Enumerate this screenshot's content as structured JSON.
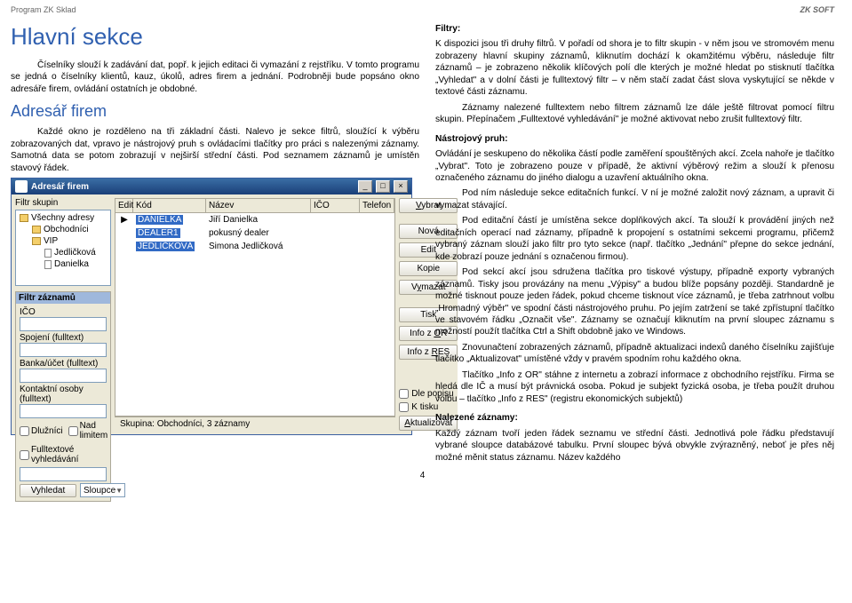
{
  "header": {
    "left": "Program ZK Sklad",
    "right": "ZK SOFT"
  },
  "left": {
    "h1": "Hlavní sekce",
    "p1": "Číselníky slouží k zadávání dat, popř. k jejich editaci či vymazání z rejstříku. V tomto programu se jedná o číselníky klientů, kauz, úkolů, adres firem a jednání. Podrobněji bude popsáno okno adresáře firem, ovládání ostatních je obdobné.",
    "h2": "Adresář firem",
    "p2": "Každé okno je rozděleno na tři základní části. Nalevo je sekce filtrů, sloužící k výběru zobrazovaných dat, vpravo je nástrojový pruh s ovládacími tlačítky pro práci s nalezenými záznamy. Samotná data se potom zobrazují v nejširší střední části. Pod seznamem záznamů je umístěn stavový řádek."
  },
  "right": {
    "filtry_head": "Filtry:",
    "filtry_body": "K dispozici jsou tři druhy filtrů. V pořadí od shora je to filtr skupin - v něm jsou ve stromovém menu zobrazeny hlavní skupiny záznamů, kliknutím dochází k okamžitému výběru, následuje filtr záznamů – je zobrazeno několik klíčových polí dle kterých je možné hledat po stisknutí tlačítka „Vyhledat\" a v dolní části je fulltextový filtr  – v něm stačí zadat část slova vyskytující se někde v textové části záznamu.",
    "filtry_body2": "Záznamy nalezené fulltextem nebo filtrem záznamů lze dále ještě filtrovat pomocí filtru skupin. Přepínačem „Fulltextové vyhledávání\" je možné aktivovat nebo zrušit fulltextový filtr.",
    "nastroj_head": "Nástrojový pruh:",
    "nastroj_p1": "Ovládání je seskupeno do několika částí podle zaměření spouštěných akcí. Zcela nahoře je tlačítko „Vybrat\". Toto je zobrazeno pouze v případě, že aktivní výběrový režim a slouží k přenosu označeného záznamu do jiného dialogu a uzavření aktuálního okna.",
    "nastroj_p2": "Pod ním následuje sekce editačních funkcí. V ní je možné založit nový záznam, a upravit či vymazat stávající.",
    "nastroj_p3": "Pod editační částí je umístěna sekce doplňkových akcí. Ta slouží k provádění jiných než editačních operací nad záznamy, případně k propojení s ostatními sekcemi programu, přičemž vybraný záznam slouží jako filtr pro tyto sekce (např. tlačítko „Jednání\" přepne do sekce jednání, kde zobrazí pouze jednání s označenou firmou).",
    "nastroj_p4": "Pod sekcí akcí jsou sdružena tlačítka pro tiskové výstupy, případně exporty vybraných záznamů. Tisky jsou provázány na menu „Výpisy\" a budou blíže popsány později. Standardně je možné tisknout pouze jeden řádek, pokud chceme tisknout více záznamů, je třeba zatrhnout volbu „Hromadný výběr\" ve spodní části nástrojového pruhu. Po jejím zatržení se také zpřístupní tlačítko ve stavovém řádku „Označit vše\". Záznamy se označují kliknutím na první sloupec záznamu s možností použít tlačítka Ctrl a Shift obdobně jako ve Windows.",
    "nastroj_p5": "Znovunačtení zobrazených záznamů, případně aktualizaci indexů daného číselníku zajišťuje tlačítko „Aktualizovat\" umístěné vždy v pravém spodním rohu každého okna.",
    "nastroj_p6": "Tlačítko „Info z OR\" stáhne z internetu a zobrazí informace z obchodního rejstříku. Firma se hledá dle IČ a musí být právnická osoba. Pokud je subjekt fyzická osoba, je třeba použít druhou volbu – tlačítko „Info z RES\" (registru ekonomických subjektů)",
    "nalez_head": "Nalezené záznamy:",
    "nalez_p1": "Každý záznam tvoří jeden řádek seznamu ve střední části. Jednotlivá pole řádku představují vybrané sloupce databázové tabulku. První sloupec bývá obvykle zvýrazněný, neboť je přes něj možné měnit status záznamu. Název každého"
  },
  "app": {
    "title": "Adresář firem",
    "tree_label": "Filtr skupin",
    "tree_root": "Všechny adresy",
    "tree_items": [
      "Obchodníci",
      "VIP"
    ],
    "tree_sub": [
      "Jedličková",
      "Danielka"
    ],
    "filter_title": "Filtr záznamů",
    "f_ico": "IČO",
    "f_spoj": "Spojení (fulltext)",
    "f_banka": "Banka/účet (fulltext)",
    "f_kontakt": "Kontaktní osoby (fulltext)",
    "chk_dluz": "Dlužníci",
    "chk_limit": "Nad limitem",
    "chk_full": "Fulltextové vyhledávání",
    "btn_vyhledat": "Vyhledat",
    "combo_sloupce": "Sloupce",
    "grid_cols": {
      "edit": "Edit",
      "kod": "Kód",
      "nazev": "Název",
      "ico": "IČO",
      "tel": "Telefon"
    },
    "rows": [
      {
        "kod": "DANIELKA",
        "nazev": "Jiří Danielka"
      },
      {
        "kod": "DEALER1",
        "nazev": "pokusný dealer"
      },
      {
        "kod": "JEDLIČKOVÁ",
        "nazev": "Simona Jedličková"
      }
    ],
    "status_left": "Skupina: Obchodníci, 3 záznamy",
    "status_chk_popis": "Dle popisu",
    "status_chk_tisk": "K tisku",
    "rbtns": {
      "vybrat": "Vybrat",
      "nova": "Nová",
      "edit": "Edit",
      "kopie": "Kopie",
      "vymazat": "Vymazat",
      "tisk": "Tisk",
      "info_or": "Info z OR",
      "info_res": "Info z RES",
      "aktual": "Aktualizovat"
    }
  },
  "page_num": "4"
}
